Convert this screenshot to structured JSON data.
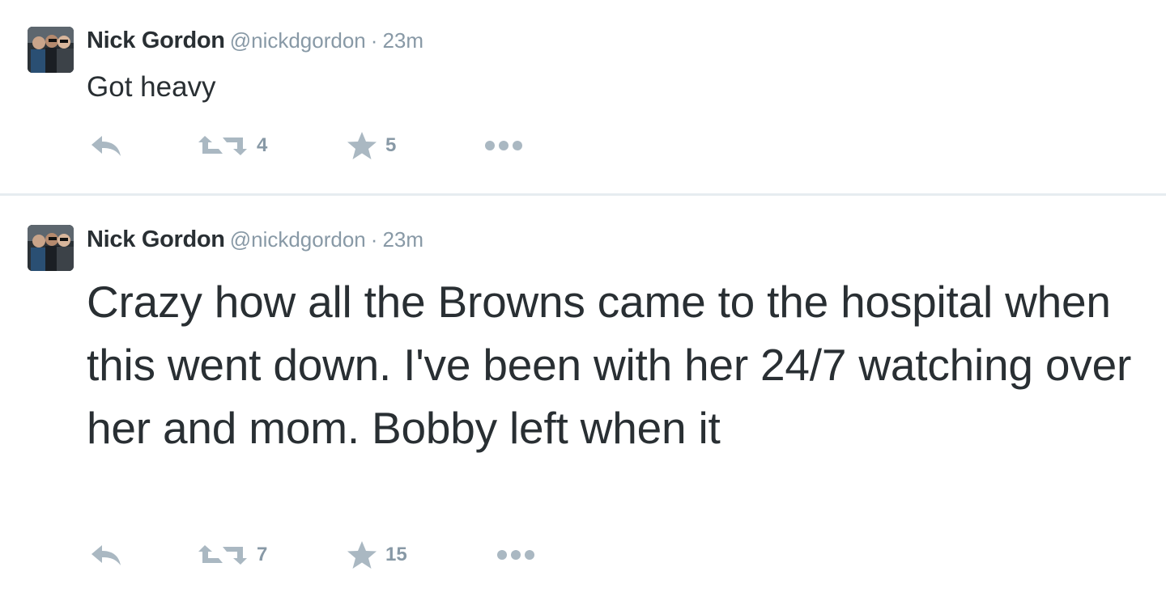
{
  "tweets": [
    {
      "fullname": "Nick Gordon",
      "username": "@nickdgordon",
      "separator": "·",
      "time": "23m",
      "text": "Got heavy",
      "retweets": "4",
      "favorites": "5"
    },
    {
      "fullname": "Nick Gordon",
      "username": "@nickdgordon",
      "separator": "·",
      "time": "23m",
      "text": "Crazy how all the Browns came to the hospital when this went down. I've been with her 24/7 watching over her and mom. Bobby left when it",
      "retweets": "7",
      "favorites": "15"
    }
  ],
  "icons": {
    "reply": "reply-icon",
    "retweet": "retweet-icon",
    "favorite": "star-icon",
    "more": "more-dots-icon"
  },
  "colors": {
    "text": "#292f33",
    "muted": "#8899a6",
    "icon": "#aab8c2",
    "divider": "#e6ecf0"
  }
}
